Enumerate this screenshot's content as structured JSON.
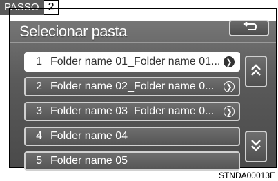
{
  "step": {
    "label": "PASSO",
    "number": "2"
  },
  "screen": {
    "title": "Selecionar pasta",
    "back_icon": "return-arrow-icon"
  },
  "folders": [
    {
      "num": "1",
      "name": "Folder name 01_Folder name 01...",
      "selected": true,
      "has_go": true
    },
    {
      "num": "2",
      "name": "Folder name 02_Folder name 0...",
      "selected": false,
      "has_go": true
    },
    {
      "num": "3",
      "name": "Folder name 03_Folder name 0...",
      "selected": false,
      "has_go": true
    },
    {
      "num": "4",
      "name": "Folder name 04",
      "selected": false,
      "has_go": false
    },
    {
      "num": "5",
      "name": "Folder name 05",
      "selected": false,
      "has_go": false
    }
  ],
  "scroll": {
    "up_icon": "double-chevron-up-icon",
    "down_icon": "double-chevron-down-icon"
  },
  "figure_code": "STNDA00013E"
}
